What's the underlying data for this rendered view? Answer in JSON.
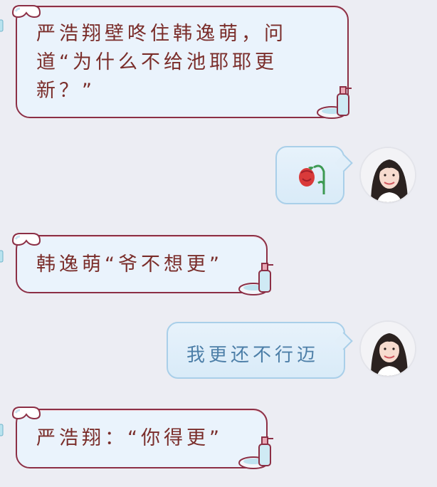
{
  "messages": [
    {
      "side": "incoming",
      "text": "严浩翔壁咚住韩逸萌，问道“为什么不给池耶耶更新？”"
    },
    {
      "side": "outgoing",
      "emoji": "wilted-rose"
    },
    {
      "side": "incoming",
      "text": "韩逸萌“爷不想更”"
    },
    {
      "side": "outgoing",
      "text": "我更还不行迈"
    },
    {
      "side": "incoming",
      "text": "严浩翔：“你得更”"
    }
  ],
  "colors": {
    "background": "#ecedf3",
    "incoming_border": "#8c2f45",
    "incoming_fill": "#eaf3fc",
    "incoming_text": "#7a2d2a",
    "outgoing_border": "#a9cfe9",
    "outgoing_text": "#4d7fa8"
  },
  "icons": [
    "goggles-icon",
    "sanitizer-bottle-icon",
    "basin-icon",
    "wilted-rose-icon",
    "avatar-girl"
  ]
}
